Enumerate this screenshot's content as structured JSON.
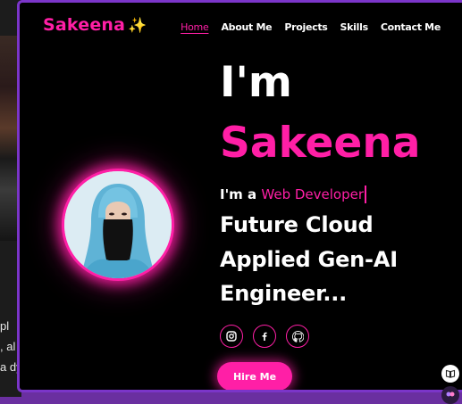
{
  "header": {
    "logo_text": "Sakeena",
    "logo_sparkle": "✨",
    "nav": [
      "Home",
      "About Me",
      "Projects",
      "Skills",
      "Contact Me"
    ],
    "active_nav": "Home"
  },
  "hero": {
    "greeting": "I'm",
    "name": "Sakeena",
    "typing_prefix": "I'm a",
    "typing_role": "Web Developer",
    "tagline_lines": [
      "Future Cloud",
      "Applied Gen-AI",
      "Engineer..."
    ],
    "hire_button": "Hire Me"
  },
  "socials": [
    "instagram-icon",
    "facebook-icon",
    "github-icon"
  ],
  "background_page": {
    "text_fragments": [
      "pl",
      ", al",
      "a dy"
    ]
  },
  "colors": {
    "accent": "#ff1fa6",
    "frame": "#7b35c9",
    "background": "#000000"
  }
}
